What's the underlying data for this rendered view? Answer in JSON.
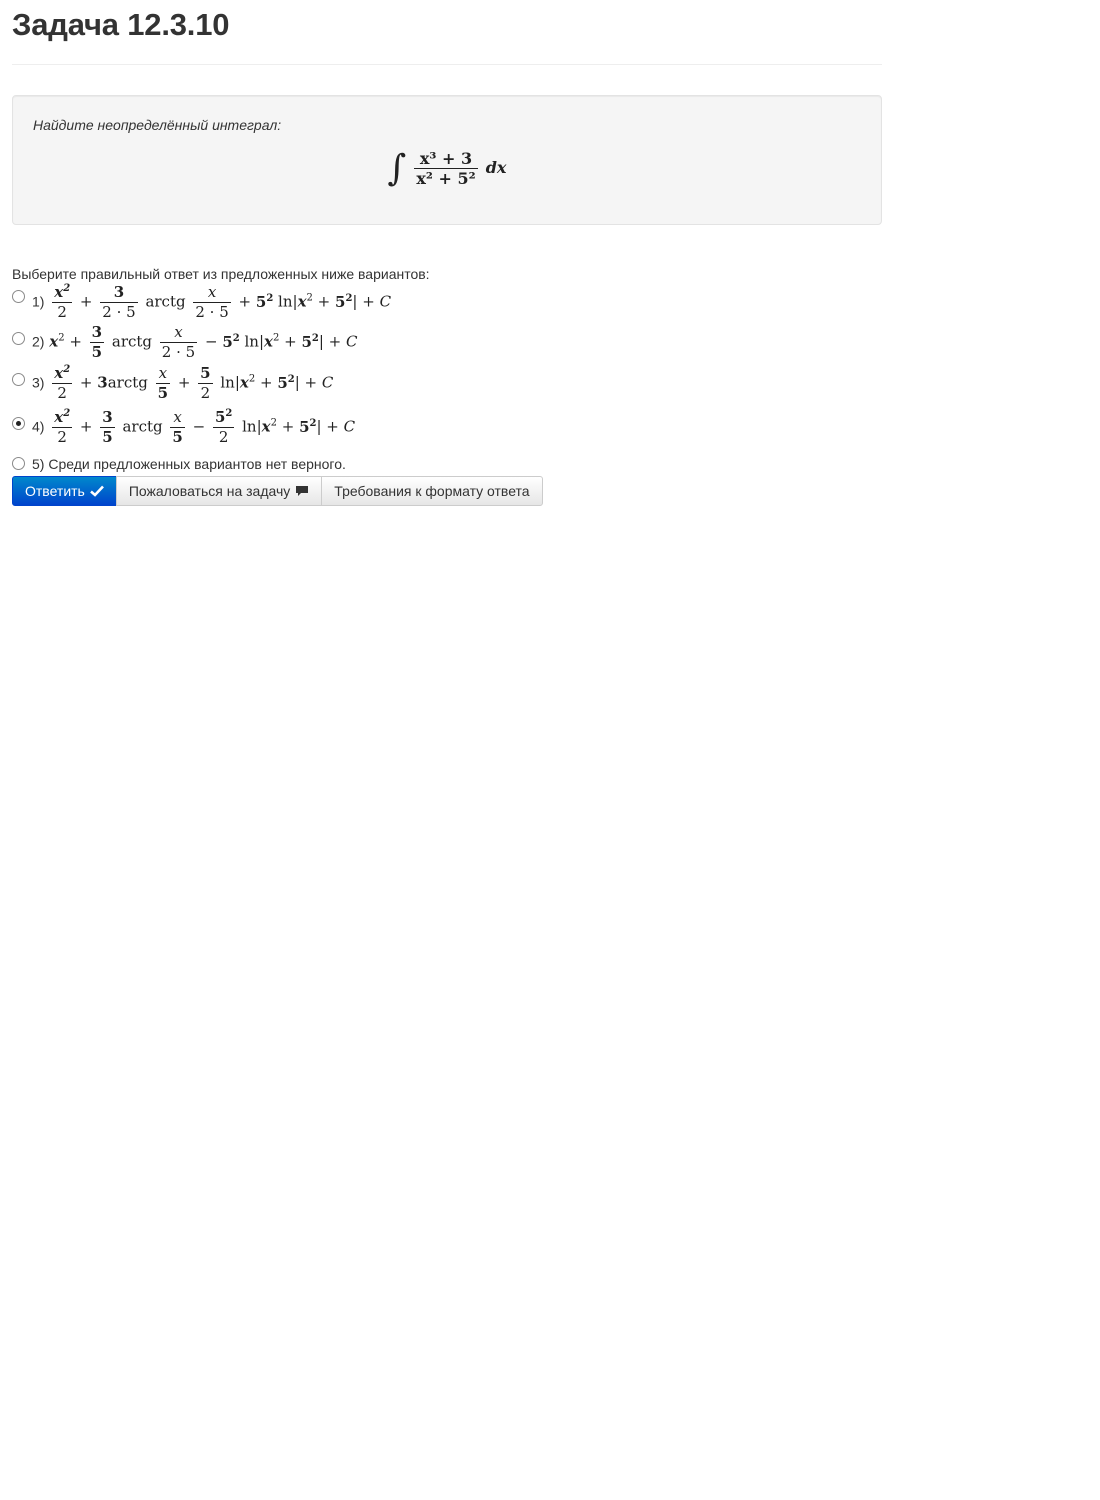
{
  "title": "Задача 12.3.10",
  "task": {
    "text": "Найдите неопределённый интеграл:",
    "integrand_num": "x³ + 3",
    "integrand_den": "x² + 5²",
    "dx": "dx"
  },
  "prompt": "Выберите правильный ответ из предложенных ниже вариантов:",
  "options": [
    {
      "label": "1)",
      "selected": false
    },
    {
      "label": "2)",
      "selected": false
    },
    {
      "label": "3)",
      "selected": false
    },
    {
      "label": "4)",
      "selected": true
    },
    {
      "label": "5)",
      "text": "Среди предложенных вариантов нет верного.",
      "selected": false
    }
  ],
  "buttons": {
    "answer": "Ответить",
    "complain": "Пожаловаться на задачу",
    "format": "Требования к формату ответа"
  },
  "colors": {
    "primary": "#0055cc",
    "well_bg": "#f5f5f5"
  },
  "icons": {
    "answer": "check-icon",
    "complain": "comment-icon"
  }
}
